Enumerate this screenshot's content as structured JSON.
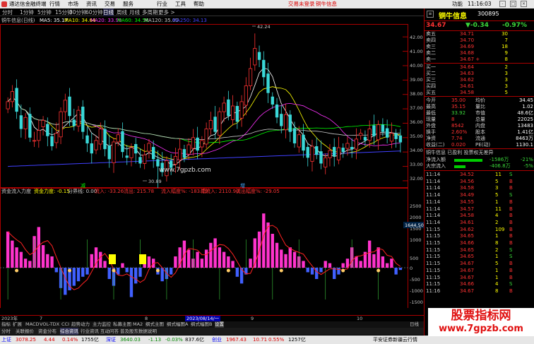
{
  "menubar": {
    "app_title": "通达信金融终端",
    "menus": [
      "行情",
      "市场",
      "资讯",
      "交易",
      "服务",
      "行业",
      "工具",
      "帮助"
    ],
    "notices": [
      "交易未登录",
      "铜牛信息"
    ],
    "right": "功能",
    "clock": "11:16:03",
    "win_buttons": [
      "-",
      "□",
      "×"
    ]
  },
  "periodbar": {
    "items": [
      "分时",
      "1分钟",
      "5分钟",
      "15分钟",
      "30分钟",
      "60分钟",
      "日线",
      "周线",
      "月线",
      "多周期",
      "更多 >"
    ],
    "active_index": 6
  },
  "main_header": {
    "title": "铜牛信息(日线)",
    "ma5": "MA5: 35.17",
    "ma10": "MA10: 34.64",
    "ma20": "MA20: 33.99",
    "ma60": "MA60: 34.58",
    "ma120": "MA120: 35.00",
    "ma250": "MA250: 34.13"
  },
  "main_chart": {
    "y_ticks": [
      "42.00",
      "41.00",
      "40.00",
      "39.00",
      "38.00",
      "37.00",
      "36.00",
      "35.00",
      "34.00",
      "33.00",
      "32.00"
    ],
    "high_label": "42.24",
    "low_label": "30.89",
    "markers": [
      "减",
      "增"
    ]
  },
  "indicator_header": {
    "title": "资金流入力度",
    "value_label": "资金力度: -0.15",
    "f1": "分界线: 0.00",
    "f2": "流入: -33.26",
    "f3": "流出: 215.78",
    "f4": "流入幅度%: -183.79",
    "f5": "幅流入: 2110.90",
    "f6": "流出幅度%: -29.05"
  },
  "indicator_chart": {
    "y_ticks": [
      "2500",
      "2000",
      "1500",
      "1000",
      "500",
      "0",
      "-500",
      "-1000",
      "-1500"
    ],
    "cursor_value": "1644.50"
  },
  "datebar": {
    "labels": [
      "2023年",
      "7",
      "8",
      "9",
      "10"
    ],
    "cursor_date": "2023/08/14/一"
  },
  "tabbar": {
    "items": [
      "指标",
      "扩展",
      "MACD",
      "VOL-TDX",
      "CCI",
      "趋势动力",
      "主力监控",
      "私募主图",
      "MA2",
      "纲式主图",
      "纲式幅图A",
      "纲式幅图B",
      "设置"
    ],
    "highlight_index": 12,
    "right": "日线"
  },
  "tabbar2": {
    "items": [
      "分时",
      "关联报价",
      "资金分布",
      "综合资讯",
      "行业资讯",
      "互动问答",
      "普及股东数据说明"
    ],
    "highlight_index": 3
  },
  "statusbar": {
    "items": [
      "上证",
      "3078.25",
      "4.44",
      "0.14%",
      "1755亿",
      "深证",
      "3640.03",
      "-1.13",
      "-0.03%",
      "837.6亿",
      "创业",
      "1967.43",
      "10.71",
      "0.55%",
      "1257亿"
    ],
    "right": "平安证券新疆云行情"
  },
  "stock": {
    "name": "铜牛信息",
    "code": "300895",
    "price": "34.67",
    "change": "▼-0.34",
    "pct": "-0.97%"
  },
  "order_book": {
    "asks": [
      {
        "label": "卖五",
        "price": "34.71",
        "vol": "30"
      },
      {
        "label": "卖四",
        "price": "34.70",
        "vol": "7"
      },
      {
        "label": "卖三",
        "price": "34.69",
        "vol": "18"
      },
      {
        "label": "卖二",
        "price": "34.68",
        "vol": "9"
      },
      {
        "label": "卖一",
        "price": "34.67 +",
        "vol": "8"
      }
    ],
    "bids": [
      {
        "label": "买一",
        "price": "34.64",
        "vol": "2"
      },
      {
        "label": "买二",
        "price": "34.63",
        "vol": "3"
      },
      {
        "label": "买三",
        "price": "34.62",
        "vol": "3"
      },
      {
        "label": "买四",
        "price": "34.61",
        "vol": "3"
      },
      {
        "label": "买五",
        "price": "34.58",
        "vol": "5"
      }
    ]
  },
  "quote_stats": [
    {
      "l1": "今开",
      "v1": "35.00",
      "l2": "均价",
      "v2": "34.45"
    },
    {
      "l1": "最高",
      "v1": "35.15",
      "l2": "量比",
      "v2": "1.02"
    },
    {
      "l1": "最低",
      "v1": "33.92",
      "l2": "市值",
      "v2": "48.6亿"
    },
    {
      "l1": "现量",
      "v1": "8",
      "l2": "总量",
      "v2": "22025"
    },
    {
      "l1": "外盘",
      "v1": "8542",
      "l2": "内盘",
      "v2": "13483"
    },
    {
      "l1": "换手",
      "v1": "2.60%",
      "l2": "股本",
      "v2": "1.41亿"
    },
    {
      "l1": "净资",
      "v1": "7.74",
      "l2": "流通",
      "v2": "8463万"
    },
    {
      "l1": "收益(二)",
      "v1": "0.020",
      "l2": "PE(动)",
      "v2": "1130.1"
    }
  ],
  "fund_flow": {
    "title": "铜牛信息 已盈利 投票权无差异",
    "rows": [
      {
        "label": "净流入额",
        "value": "-1586万",
        "pct": "-21%"
      },
      {
        "label": "大宗流入",
        "value": "-406.8万",
        "pct": "-5%"
      }
    ]
  },
  "ticks": [
    {
      "t": "11:14",
      "p": "34.52",
      "v": "11",
      "d": "S"
    },
    {
      "t": "11:14",
      "p": "34.56",
      "v": "5",
      "d": "B"
    },
    {
      "t": "11:14",
      "p": "34.58",
      "v": "3",
      "d": "B"
    },
    {
      "t": "11:14",
      "p": "34.49",
      "v": "5",
      "d": "S"
    },
    {
      "t": "11:14",
      "p": "34.55",
      "v": "1",
      "d": "B"
    },
    {
      "t": "11:14",
      "p": "34.57",
      "v": "11",
      "d": "B"
    },
    {
      "t": "11:14",
      "p": "34.58",
      "v": "4",
      "d": "B"
    },
    {
      "t": "11:14",
      "p": "34.61",
      "v": "2",
      "d": "B"
    },
    {
      "t": "11:15",
      "p": "34.62",
      "v": "109",
      "d": "B"
    },
    {
      "t": "11:15",
      "p": "34.65",
      "v": "1",
      "d": "B"
    },
    {
      "t": "11:15",
      "p": "34.66",
      "v": "8",
      "d": "B"
    },
    {
      "t": "11:15",
      "p": "34.65",
      "v": "2",
      "d": "S"
    },
    {
      "t": "11:15",
      "p": "34.65",
      "v": "1",
      "d": "S"
    },
    {
      "t": "11:15",
      "p": "34.67",
      "v": "5",
      "d": "B"
    },
    {
      "t": "11:15",
      "p": "34.67",
      "v": "1",
      "d": "B"
    },
    {
      "t": "11:15",
      "p": "34.67",
      "v": "1",
      "d": "B"
    },
    {
      "t": "11:15",
      "p": "34.66",
      "v": "4",
      "d": "S"
    },
    {
      "t": "11:16",
      "p": "34.67",
      "v": "8",
      "d": "B"
    }
  ],
  "watermark": {
    "line1": "股票指标网",
    "line2": "www.7gpzb.com"
  },
  "site_text": "www.7gpzb.com",
  "colors": {
    "up": "#ff3232",
    "down": "#3ad8d8",
    "ma5": "#ffffff",
    "ma10": "#ffff00",
    "ma20": "#ff33ff",
    "ma60": "#00ff00",
    "ma120": "#c8c8c8",
    "ma250": "#4040ff",
    "pink": "#ff33cc",
    "blue": "#4060ff"
  }
}
